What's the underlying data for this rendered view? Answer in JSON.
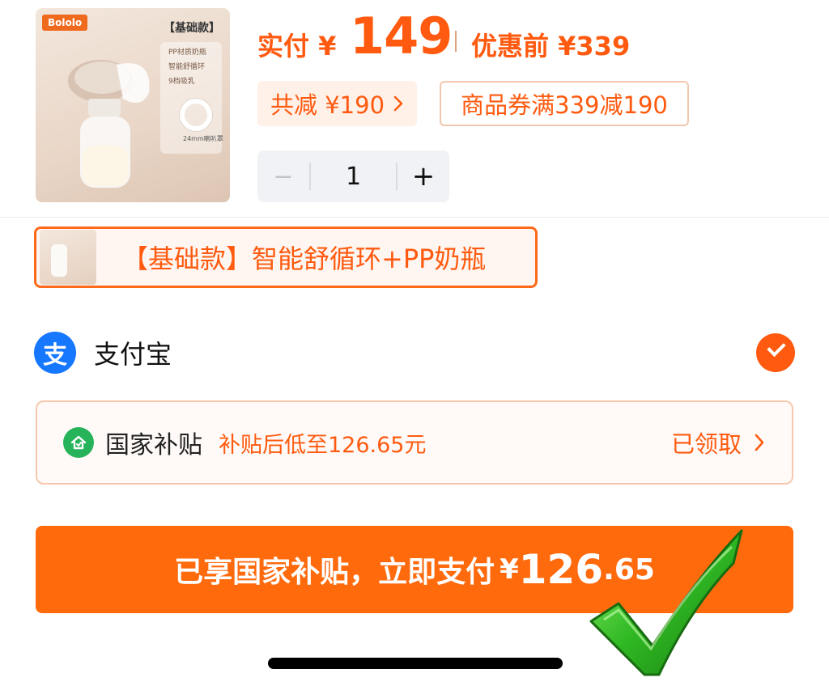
{
  "product": {
    "brand": "Bololo",
    "tag": "【基础款】",
    "specs": [
      "PP材质奶瓶",
      "智能舒循环",
      "9档吸乳"
    ],
    "spec_footer": "24mm喇叭罩"
  },
  "price": {
    "paid_label": "实付 ¥",
    "paid_value": "149",
    "original_label": "优惠前 ¥339"
  },
  "discount": {
    "total_label": "共减 ¥190",
    "coupon_label": "商品券满339减190"
  },
  "quantity": {
    "minus": "−",
    "value": "1",
    "plus": "+"
  },
  "variant": {
    "label": "【基础款】智能舒循环+PP奶瓶"
  },
  "payment": {
    "icon_glyph": "支",
    "method": "支付宝",
    "selected": true
  },
  "subsidy": {
    "title": "国家补贴",
    "description": "补贴后低至126.65元",
    "status": "已领取"
  },
  "pay_button": {
    "text": "已享国家补贴，立即支付",
    "currency": "¥",
    "amount_int": "126",
    "amount_dec": ".65"
  },
  "colors": {
    "accent": "#ff5a0f",
    "button": "#ff6a0d",
    "alipay": "#1677ff",
    "subsidy_green": "#27b35a"
  }
}
